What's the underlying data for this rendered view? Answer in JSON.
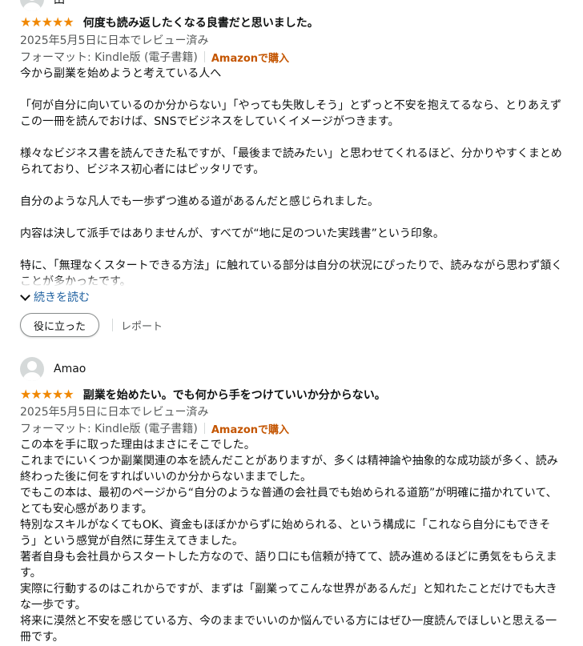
{
  "reviews": [
    {
      "profile_name": "田",
      "title": "何度も読み返したくなる良書だと思いました。",
      "meta": "2025年5月5日に日本でレビュー済み",
      "format": "フォーマット: Kindle版 (電子書籍)",
      "verified": "Amazonで購入",
      "paragraphs": [
        "今から副業を始めようと考えている人へ",
        "「何が自分に向いているのか分からない」「やっても失敗しそう」とずっと不安を抱えてるなら、とりあえずこの一冊を読んでおけば、SNSでビジネスをしていくイメージがつきます。",
        "様々なビジネス書を読んできた私ですが、「最後まで読みたい」と思わせてくれるほど、分かりやすくまとめられており、ビジネス初心者にはピッタリです。",
        "自分のような凡人でも一歩ずつ進める道があるんだと感じられました。",
        "内容は決して派手ではありませんが、すべてが“地に足のついた実践書”という印象。",
        "特に、「無理なくスタートできる方法」に触れている部分は自分の状況にぴったりで、読みながら思わず頷くことが多かったです。"
      ],
      "read_more": "続きを読む",
      "helpful_label": "役に立った",
      "report_label": "レポート"
    },
    {
      "profile_name": "Amao",
      "title": "副業を始めたい。でも何から手をつけていいか分からない。",
      "meta": "2025年5月5日に日本でレビュー済み",
      "format": "フォーマット: Kindle版 (電子書籍)",
      "verified": "Amazonで購入",
      "paragraphs": [
        "この本を手に取った理由はまさにそこでした。",
        "これまでにいくつか副業関連の本を読んだことがありますが、多くは精神論や抽象的な成功談が多く、読み終わった後に何をすればいいのか分からないままでした。",
        "でもこの本は、最初のページから“自分のような普通の会社員でも始められる道筋”が明確に描かれていて、とても安心感があります。",
        "特別なスキルがなくてもOK、資金もほぼかからずに始められる、という構成に「これなら自分にもできそう」という感覚が自然に芽生えてきました。",
        "著者自身も会社員からスタートした方なので、語り口にも信頼が持てて、読み進めるほどに勇気をもらえます。",
        "実際に行動するのはこれからですが、まずは「副業ってこんな世界があるんだ」と知れたことだけでも大きな一歩です。",
        "将来に漠然と不安を感じている方、今のままでいいのか悩んでいる方にはぜひ一度読んでほしいと思える一冊です。"
      ]
    }
  ],
  "colors": {
    "star": "#f08804",
    "verified": "#c45500",
    "link": "#2162a1",
    "meta": "#565959"
  },
  "icons": {
    "avatar": "default-avatar-icon",
    "star": "star-icon",
    "chevron": "chevron-down-icon"
  },
  "rating": 5
}
